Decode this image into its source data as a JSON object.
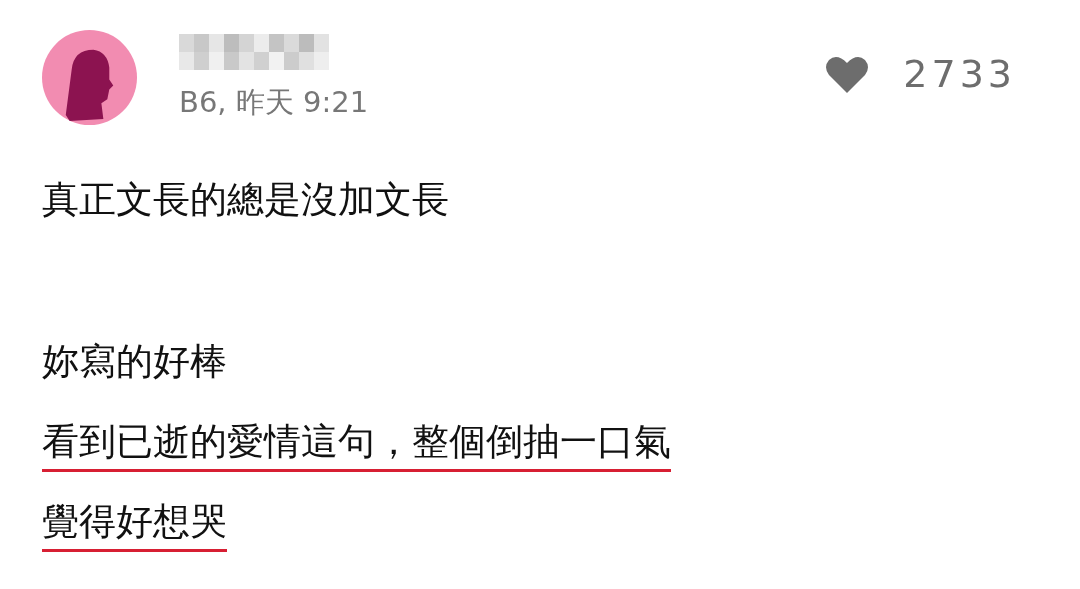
{
  "post": {
    "meta": "B6, 昨天 9:21",
    "likes": "2733"
  },
  "paragraphs": [
    {
      "lines": [
        {
          "text": "真正文長的總是沒加文長",
          "underlined": false
        }
      ]
    },
    {
      "lines": [
        {
          "text": "妳寫的好棒",
          "underlined": false
        },
        {
          "text": "看到已逝的愛情這句，整個倒抽一口氣",
          "underlined": true
        },
        {
          "text": "覺得好想哭",
          "underlined": true
        }
      ]
    }
  ]
}
